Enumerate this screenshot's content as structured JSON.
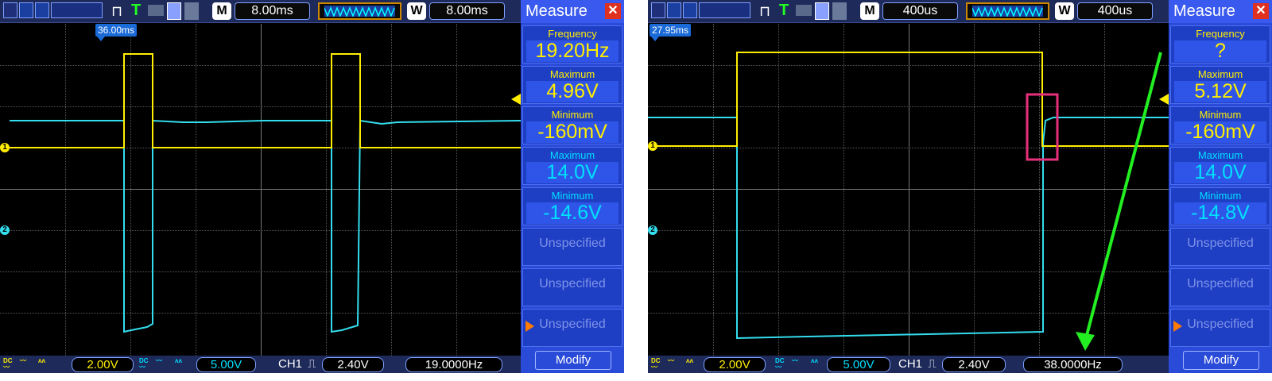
{
  "scopes": [
    {
      "id": "left",
      "toolbar": {
        "mode": "M",
        "timebase": "8.00ms",
        "window_mode": "W",
        "window_timebase": "8.00ms"
      },
      "trigger_position": "36.00ms",
      "status": {
        "ch1_scale": "2.00V",
        "ch2_scale": "5.00V",
        "trigger_source": "CH1",
        "trigger_level": "2.40V",
        "frequency": "19.0000Hz"
      },
      "panel": {
        "title": "Measure",
        "items": [
          {
            "label": "Frequency",
            "value": "19.20Hz",
            "color": "#ffee00"
          },
          {
            "label": "Maximum",
            "value": "4.96V",
            "color": "#ffee00"
          },
          {
            "label": "Minimum",
            "value": "-160mV",
            "color": "#ffee00"
          },
          {
            "label": "Maximum",
            "value": "14.0V",
            "color": "#00e0ff"
          },
          {
            "label": "Minimum",
            "value": "-14.6V",
            "color": "#00e0ff"
          }
        ],
        "unspecified": [
          "Unspecified",
          "Unspecified",
          "Unspecified"
        ],
        "modify": "Modify"
      }
    },
    {
      "id": "right",
      "toolbar": {
        "mode": "M",
        "timebase": "400us",
        "window_mode": "W",
        "window_timebase": "400us"
      },
      "trigger_position": "27.95ms",
      "status": {
        "ch1_scale": "2.00V",
        "ch2_scale": "5.00V",
        "trigger_source": "CH1",
        "trigger_level": "2.40V",
        "frequency": "38.0000Hz"
      },
      "panel": {
        "title": "Measure",
        "items": [
          {
            "label": "Frequency",
            "value": "?",
            "color": "#ffee00"
          },
          {
            "label": "Maximum",
            "value": "5.12V",
            "color": "#ffee00"
          },
          {
            "label": "Minimum",
            "value": "-160mV",
            "color": "#ffee00"
          },
          {
            "label": "Maximum",
            "value": "14.0V",
            "color": "#00e0ff"
          },
          {
            "label": "Minimum",
            "value": "-14.8V",
            "color": "#00e0ff"
          }
        ],
        "unspecified": [
          "Unspecified",
          "Unspecified",
          "Unspecified"
        ],
        "modify": "Modify"
      }
    }
  ],
  "channel_markers": {
    "ch1": "1",
    "ch2": "2"
  },
  "colors": {
    "ch1": "#ffee00",
    "ch2": "#33ddee",
    "annotation_box": "#e8307a",
    "annotation_arrow": "#22ee22",
    "panel_bg": "#2a4ad8"
  }
}
